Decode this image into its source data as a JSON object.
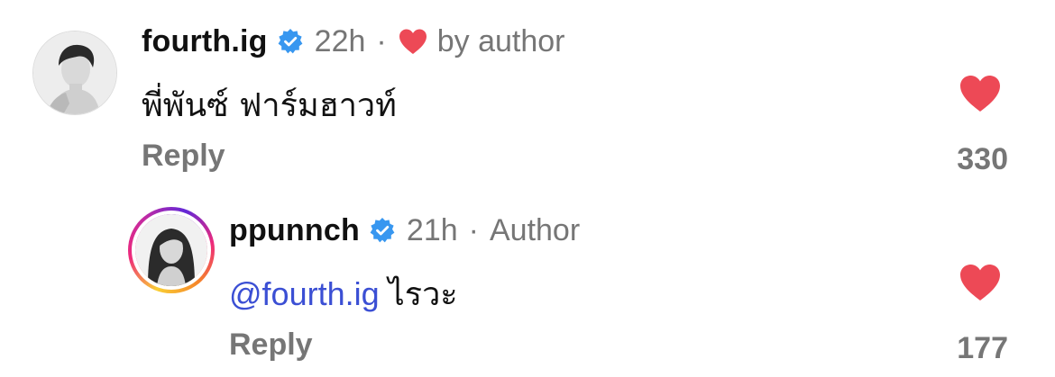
{
  "comments": [
    {
      "username": "fourth.ig",
      "verified": true,
      "time": "22h",
      "separator": "·",
      "badge": "by author",
      "badge_icon": "red-heart-icon",
      "text": "พี่พันซ์ ฟาร์มฮาวท์",
      "reply_label": "Reply",
      "like_count": "330",
      "liked": true
    },
    {
      "username": "ppunnch",
      "verified": true,
      "time": "21h",
      "separator": "·",
      "badge": "Author",
      "mention": "@fourth.ig",
      "text": "ไรวะ",
      "reply_label": "Reply",
      "like_count": "177",
      "liked": true,
      "story_ring": true
    }
  ],
  "colors": {
    "heart": "#ed4956",
    "verified": "#3897f0",
    "mention": "#3b4fd4",
    "muted": "#767676"
  }
}
